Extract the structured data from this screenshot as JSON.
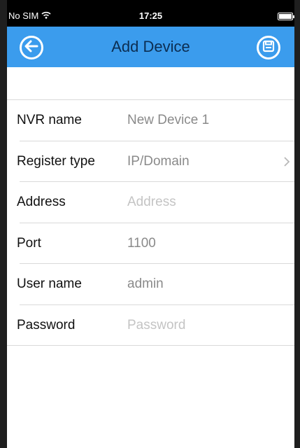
{
  "status_bar": {
    "carrier": "No SIM",
    "time": "17:25"
  },
  "nav": {
    "title": "Add Device",
    "back_icon": "back-arrow-icon",
    "save_icon": "save-icon"
  },
  "colors": {
    "nav_background": "#3b9ced",
    "nav_title": "#0c2e52"
  },
  "form": {
    "nvr_name": {
      "label": "NVR name",
      "value": "New Device 1"
    },
    "register_type": {
      "label": "Register type",
      "value": "IP/Domain"
    },
    "address": {
      "label": "Address",
      "placeholder": "Address"
    },
    "port": {
      "label": "Port",
      "value": "1100"
    },
    "user_name": {
      "label": "User name",
      "value": "admin"
    },
    "password": {
      "label": "Password",
      "placeholder": "Password"
    }
  }
}
